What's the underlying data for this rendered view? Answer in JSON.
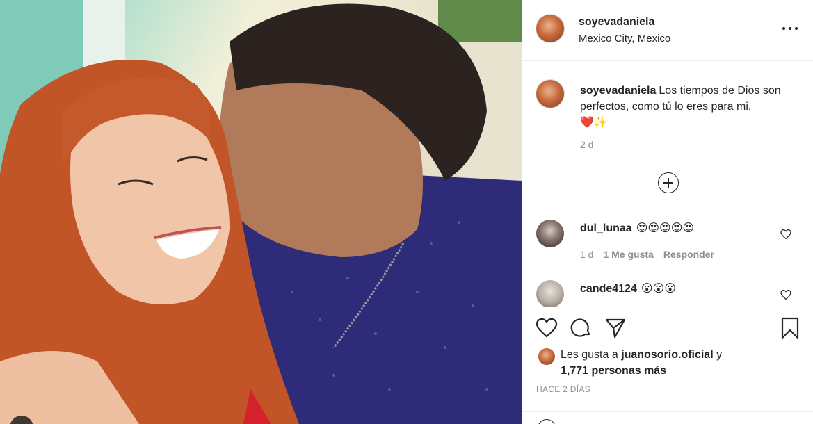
{
  "post": {
    "username": "soyevadaniela",
    "location": "Mexico City, Mexico"
  },
  "caption": {
    "username": "soyevadaniela",
    "text": "Los tiempos de Dios son perfectos, como tú lo eres para mi.",
    "emoji": "❤️✨",
    "time": "2 d"
  },
  "comments": [
    {
      "username": "dul_lunaa",
      "text": "😍😍😍😍😍",
      "time": "1 d",
      "likes": "1 Me gusta",
      "reply": "Responder"
    },
    {
      "username": "cande4124",
      "text": "😮😮😮",
      "time": "",
      "likes": "",
      "reply": ""
    }
  ],
  "likes": {
    "prefix": "Les gusta a",
    "user": "juanosorio.oficial",
    "conj": "y",
    "count": "1,771 personas más"
  },
  "date": "HACE 2 DÍAS",
  "icons": {
    "more": "more-options-icon",
    "like": "heart-icon",
    "comment": "comment-icon",
    "share": "share-icon",
    "save": "bookmark-icon",
    "load_more": "plus-circle-icon"
  },
  "colors": {
    "text": "#262626",
    "secondary": "#8e8e8e",
    "heart": "#ed4956",
    "border": "#efefef"
  }
}
